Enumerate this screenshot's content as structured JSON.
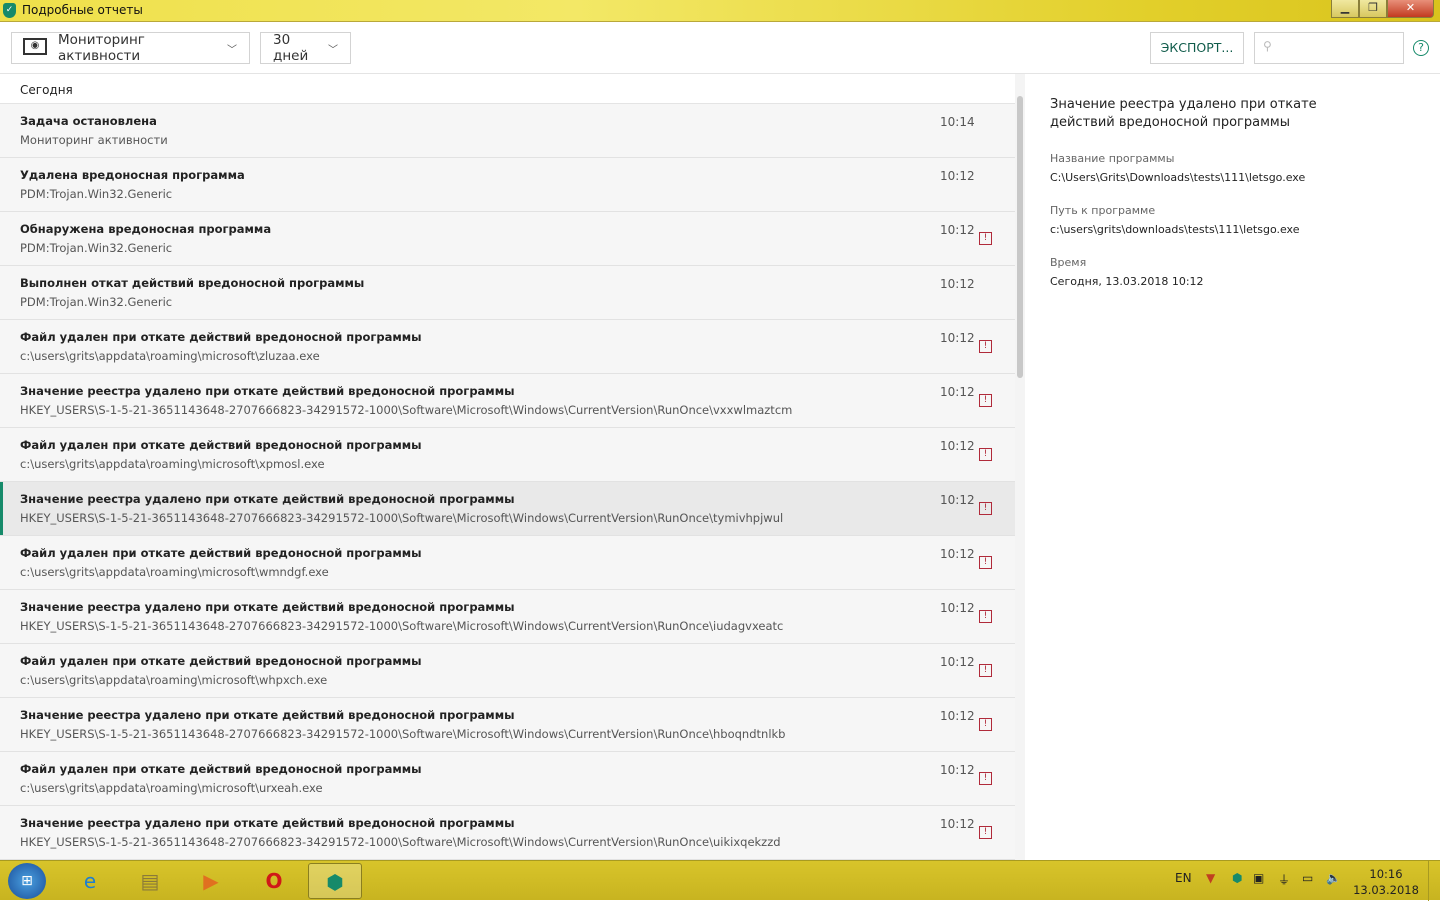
{
  "window": {
    "title": "Подробные отчеты"
  },
  "toolbar": {
    "component": "Мониторинг активности",
    "period": "30 дней",
    "export_label": "ЭКСПОРТ...",
    "search_placeholder": ""
  },
  "list": {
    "group": "Сегодня",
    "rows": [
      {
        "title": "Задача остановлена",
        "sub": "Мониторинг активности",
        "time": "10:14",
        "alert": false
      },
      {
        "title": "Удалена вредоносная программа",
        "sub": "PDM:Trojan.Win32.Generic",
        "time": "10:12",
        "alert": false
      },
      {
        "title": "Обнаружена вредоносная программа",
        "sub": "PDM:Trojan.Win32.Generic",
        "time": "10:12",
        "alert": true
      },
      {
        "title": "Выполнен откат действий вредоносной программы",
        "sub": "PDM:Trojan.Win32.Generic",
        "time": "10:12",
        "alert": false
      },
      {
        "title": "Файл удален при откате действий вредоносной программы",
        "sub": "c:\\users\\grits\\appdata\\roaming\\microsoft\\zluzaa.exe",
        "time": "10:12",
        "alert": true
      },
      {
        "title": "Значение реестра удалено при откате действий вредоносной программы",
        "sub": "HKEY_USERS\\S-1-5-21-3651143648-2707666823-34291572-1000\\Software\\Microsoft\\Windows\\CurrentVersion\\RunOnce\\vxxwlmaztcm",
        "time": "10:12",
        "alert": true
      },
      {
        "title": "Файл удален при откате действий вредоносной программы",
        "sub": "c:\\users\\grits\\appdata\\roaming\\microsoft\\xpmosl.exe",
        "time": "10:12",
        "alert": true
      },
      {
        "title": "Значение реестра удалено при откате действий вредоносной программы",
        "sub": "HKEY_USERS\\S-1-5-21-3651143648-2707666823-34291572-1000\\Software\\Microsoft\\Windows\\CurrentVersion\\RunOnce\\tymivhpjwul",
        "time": "10:12",
        "alert": true,
        "selected": true
      },
      {
        "title": "Файл удален при откате действий вредоносной программы",
        "sub": "c:\\users\\grits\\appdata\\roaming\\microsoft\\wmndgf.exe",
        "time": "10:12",
        "alert": true
      },
      {
        "title": "Значение реестра удалено при откате действий вредоносной программы",
        "sub": "HKEY_USERS\\S-1-5-21-3651143648-2707666823-34291572-1000\\Software\\Microsoft\\Windows\\CurrentVersion\\RunOnce\\iudagvxeatc",
        "time": "10:12",
        "alert": true
      },
      {
        "title": "Файл удален при откате действий вредоносной программы",
        "sub": "c:\\users\\grits\\appdata\\roaming\\microsoft\\whpxch.exe",
        "time": "10:12",
        "alert": true
      },
      {
        "title": "Значение реестра удалено при откате действий вредоносной программы",
        "sub": "HKEY_USERS\\S-1-5-21-3651143648-2707666823-34291572-1000\\Software\\Microsoft\\Windows\\CurrentVersion\\RunOnce\\hboqndtnlkb",
        "time": "10:12",
        "alert": true
      },
      {
        "title": "Файл удален при откате действий вредоносной программы",
        "sub": "c:\\users\\grits\\appdata\\roaming\\microsoft\\urxeah.exe",
        "time": "10:12",
        "alert": true
      },
      {
        "title": "Значение реестра удалено при откате действий вредоносной программы",
        "sub": "HKEY_USERS\\S-1-5-21-3651143648-2707666823-34291572-1000\\Software\\Microsoft\\Windows\\CurrentVersion\\RunOnce\\uikixqekzzd",
        "time": "10:12",
        "alert": true
      }
    ]
  },
  "detail": {
    "title": "Значение реестра удалено при откате действий вредоносной программы",
    "fields": [
      {
        "label": "Название программы",
        "value": "C:\\Users\\Grits\\Downloads\\tests\\111\\letsgo.exe"
      },
      {
        "label": "Путь к программе",
        "value": "c:\\users\\grits\\downloads\\tests\\111\\letsgo.exe"
      },
      {
        "label": "Время",
        "value": "Сегодня, 13.03.2018 10:12"
      }
    ]
  },
  "taskbar": {
    "lang": "EN",
    "time": "10:16",
    "date": "13.03.2018"
  },
  "colors": {
    "accent": "#168a6a",
    "alert": "#b02a3a"
  }
}
